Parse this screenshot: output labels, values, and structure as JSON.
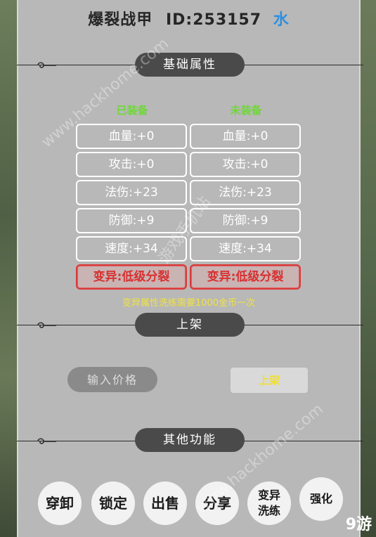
{
  "header": {
    "item_name": "爆裂战甲",
    "id_text": "ID:253157",
    "element": "水"
  },
  "sections": {
    "attributes": "基础属性",
    "listing": "上架",
    "other": "其他功能"
  },
  "columns": {
    "equipped": "已装备",
    "unequipped": "未装备"
  },
  "stats": {
    "equipped": [
      "血量:+0",
      "攻击:+0",
      "法伤:+23",
      "防御:+9",
      "速度:+34"
    ],
    "unequipped": [
      "血量:+0",
      "攻击:+0",
      "法伤:+23",
      "防御:+9",
      "速度:+34"
    ],
    "mutation_equipped": "变异:低级分裂",
    "mutation_unequipped": "变异:低级分裂"
  },
  "note": "变异属性洗练需要1000金币一次",
  "listing": {
    "price_placeholder": "输入价格",
    "list_button": "上架"
  },
  "functions": {
    "wear": "穿卸",
    "lock": "锁定",
    "sell": "出售",
    "share": "分享",
    "mutate": "变异洗练",
    "enhance": "强化"
  },
  "watermarks": {
    "url": "www.hackhome.com",
    "site": "游戏手机站"
  },
  "logo": "9游",
  "colors": {
    "panel": "#b8b8b8",
    "element_blue": "#2f8fe0",
    "column_green": "#6fd838",
    "mutation_red": "#d92f2f",
    "note_yellow": "#f2e33a"
  }
}
